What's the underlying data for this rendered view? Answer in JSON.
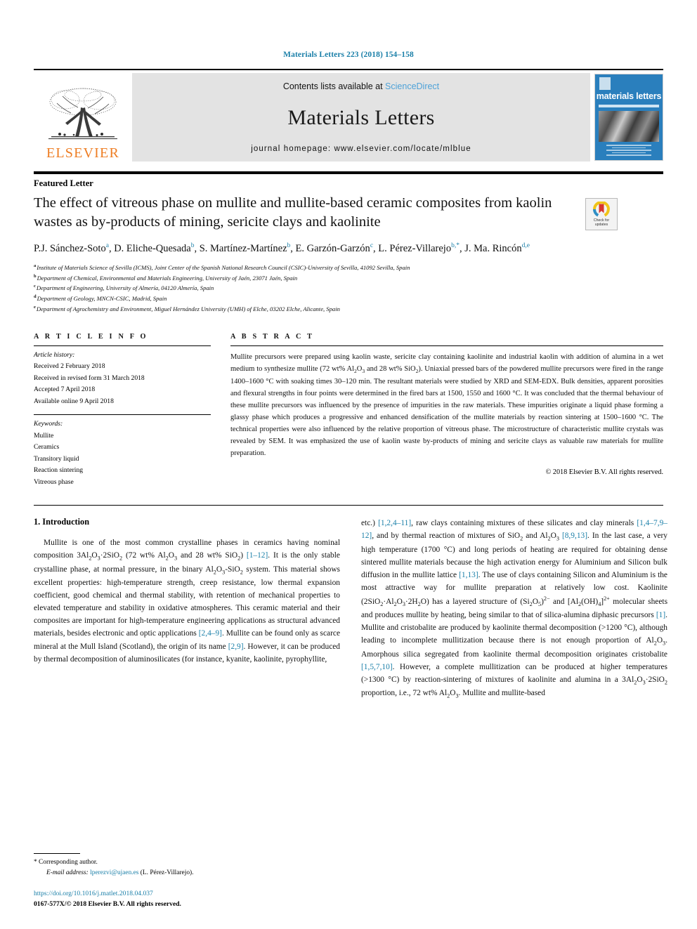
{
  "journal_ref": "Materials Letters 223 (2018) 154–158",
  "masthead": {
    "publisher": "ELSEVIER",
    "contents_prefix": "Contents lists available at ",
    "contents_link": "ScienceDirect",
    "journal_name": "Materials Letters",
    "homepage": "journal homepage: www.elsevier.com/locate/mlblue",
    "cover_title": "materials letters",
    "accent_orange": "#ee7d23",
    "accent_blue": "#4ea2d8",
    "cover_blue": "#2a7fbd"
  },
  "article": {
    "type": "Featured Letter",
    "title": "The effect of vitreous phase on mullite and mullite-based ceramic composites from kaolin wastes as by-products of mining, sericite clays and kaolinite",
    "crossmark_line1": "Check for",
    "crossmark_line2": "updates"
  },
  "authors": [
    {
      "name": "P.J. Sánchez-Soto",
      "marks": "a"
    },
    {
      "name": "D. Eliche-Quesada",
      "marks": "b"
    },
    {
      "name": "S. Martínez-Martínez",
      "marks": "b"
    },
    {
      "name": "E. Garzón-Garzón",
      "marks": "c"
    },
    {
      "name": "L. Pérez-Villarejo",
      "marks": "b,*"
    },
    {
      "name": "J. Ma. Rincón",
      "marks": "d,e"
    }
  ],
  "affiliations": [
    {
      "mark": "a",
      "text": "Institute of Materials Science of Sevilla (ICMS), Joint Center of the Spanish National Research Council (CSIC)-University of Sevilla, 41092 Sevilla, Spain"
    },
    {
      "mark": "b",
      "text": "Department of Chemical, Environmental and Materials Engineering, University of Jaén, 23071 Jaén, Spain"
    },
    {
      "mark": "c",
      "text": "Department of Engineering, University of Almería, 04120 Almería, Spain"
    },
    {
      "mark": "d",
      "text": "Department of Geology, MNCN-CSIC, Madrid, Spain"
    },
    {
      "mark": "e",
      "text": "Department of Agrochemistry and Environment, Miguel Hernández University (UMH) of Elche, 03202 Elche, Alicante, Spain"
    }
  ],
  "article_info": {
    "label": "A R T I C L E  I N F O",
    "history_heading": "Article history:",
    "history": [
      "Received 2 February 2018",
      "Received in revised form 31 March 2018",
      "Accepted 7 April 2018",
      "Available online 9 April 2018"
    ],
    "keywords_heading": "Keywords:",
    "keywords": [
      "Mullite",
      "Ceramics",
      "Transitory liquid",
      "Reaction sintering",
      "Vitreous phase"
    ]
  },
  "abstract": {
    "label": "A B S T R A C T",
    "copyright": "© 2018 Elsevier B.V. All rights reserved."
  },
  "body": {
    "section_1_heading": "1. Introduction",
    "refs": {
      "r1_12": "[1–12]",
      "r2_4_9": "[2,4–9]",
      "r2_9": "[2,9]",
      "r1_2_4_11": "[1,2,4–11]",
      "r1_4_7_9_12": "[1,4–7,9–12]",
      "r8_9_13": "[8,9,13]",
      "r1_13": "[1,13]",
      "r1": "[1]",
      "r1_5_7_10": "[1,5,7,10]"
    }
  },
  "footnote": {
    "star": "*",
    "corresponding": "Corresponding author.",
    "email_label": "E-mail address:",
    "email": "lperezvi@ujaen.es",
    "email_owner": "(L. Pérez-Villarejo)."
  },
  "footer": {
    "doi": "https://doi.org/10.1016/j.matlet.2018.04.037",
    "issn": "0167-577X/© 2018 Elsevier B.V. All rights reserved."
  }
}
